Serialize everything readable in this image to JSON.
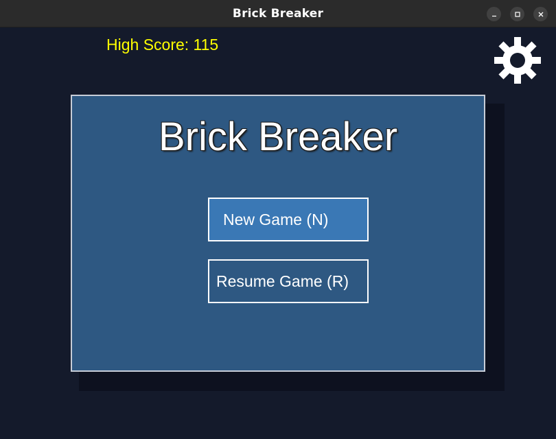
{
  "window": {
    "title": "Brick Breaker",
    "controls": {
      "minimize_icon": "minimize-icon",
      "maximize_icon": "maximize-icon",
      "close_icon": "close-icon"
    }
  },
  "hud": {
    "high_score": "High Score: 115",
    "settings_icon": "gear-icon"
  },
  "menu": {
    "title": "Brick Breaker",
    "buttons": [
      {
        "label": "New Game (N)",
        "state": "highlighted"
      },
      {
        "label": "Resume Game (R)",
        "state": "normal"
      }
    ]
  },
  "colors": {
    "background": "#141a2b",
    "panel": "#2e5882",
    "button_highlight": "#3a78b5",
    "high_score_text": "#ffff00",
    "text": "#ffffff"
  }
}
